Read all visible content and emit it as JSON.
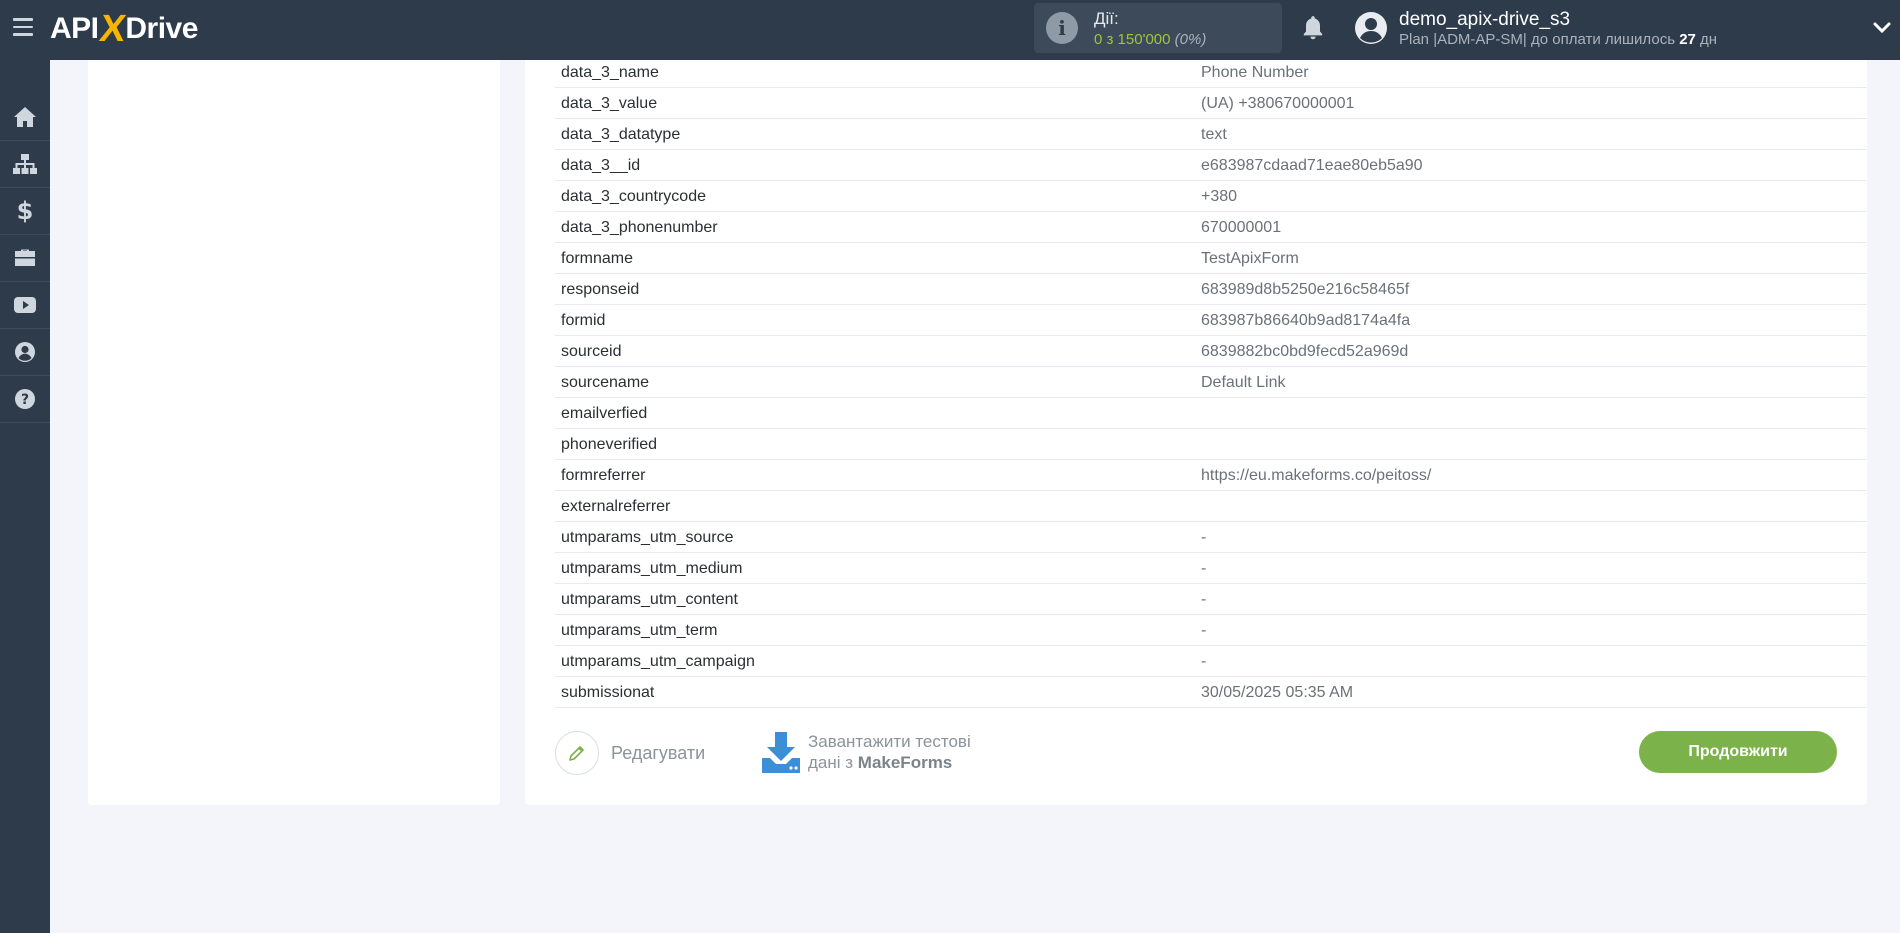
{
  "header": {
    "logo_left": "API",
    "logo_x": "X",
    "logo_right": "Drive",
    "actions_label": "Дії:",
    "actions_count": "0 з 150'000",
    "actions_pct": "(0%)",
    "username": "demo_apix-drive_s3",
    "plan_prefix": "Plan |ADM-AP-SM| до оплати лишилось ",
    "plan_days": "27",
    "plan_suffix": " дн"
  },
  "sidebar": {
    "items": [
      "home-icon",
      "sitemap-icon",
      "dollar-icon",
      "briefcase-icon",
      "youtube-icon",
      "user-icon",
      "help-icon"
    ]
  },
  "table": {
    "rows": [
      {
        "key": "data_3_name",
        "value": "Phone Number"
      },
      {
        "key": "data_3_value",
        "value": "(UA) +380670000001"
      },
      {
        "key": "data_3_datatype",
        "value": "text"
      },
      {
        "key": "data_3__id",
        "value": "e683987cdaad71eae80eb5a90"
      },
      {
        "key": "data_3_countrycode",
        "value": "+380"
      },
      {
        "key": "data_3_phonenumber",
        "value": "670000001"
      },
      {
        "key": "formname",
        "value": "TestApixForm"
      },
      {
        "key": "responseid",
        "value": "683989d8b5250e216c58465f"
      },
      {
        "key": "formid",
        "value": "683987b86640b9ad8174a4fa"
      },
      {
        "key": "sourceid",
        "value": "6839882bc0bd9fecd52a969d"
      },
      {
        "key": "sourcename",
        "value": "Default Link"
      },
      {
        "key": "emailverfied",
        "value": ""
      },
      {
        "key": "phoneverified",
        "value": ""
      },
      {
        "key": "formreferrer",
        "value": "https://eu.makeforms.co/peitoss/"
      },
      {
        "key": "externalreferrer",
        "value": ""
      },
      {
        "key": "utmparams_utm_source",
        "value": "-"
      },
      {
        "key": "utmparams_utm_medium",
        "value": "-"
      },
      {
        "key": "utmparams_utm_content",
        "value": "-"
      },
      {
        "key": "utmparams_utm_term",
        "value": "-"
      },
      {
        "key": "utmparams_utm_campaign",
        "value": "-"
      },
      {
        "key": "submissionat",
        "value": "30/05/2025 05:35 AM"
      }
    ]
  },
  "actions": {
    "edit_label": "Редагувати",
    "load_line1": "Завантажити тестові",
    "load_line2_prefix": "дані з ",
    "load_service": "MakeForms",
    "continue_label": "Продовжити"
  },
  "colors": {
    "topbar": "#2e3b4b",
    "accent_green": "#7cb24a",
    "logo_yellow": "#f7b500",
    "background": "#f3f5fa"
  }
}
